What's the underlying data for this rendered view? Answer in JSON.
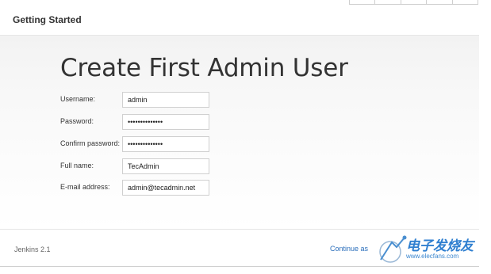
{
  "header": {
    "title": "Getting Started"
  },
  "form": {
    "title": "Create First Admin User",
    "fields": [
      {
        "label": "Username:",
        "value": "admin"
      },
      {
        "label": "Password:",
        "value": "••••••••••••••"
      },
      {
        "label": "Confirm password:",
        "value": "••••••••••••••"
      },
      {
        "label": "Full name:",
        "value": "TecAdmin"
      },
      {
        "label": "E-mail address:",
        "value": "admin@tecadmin.net"
      }
    ]
  },
  "footer": {
    "version": "Jenkins 2.1",
    "continue_label": "Continue as"
  },
  "watermark": {
    "text": "电子发烧友",
    "sub": "www.elecfans.com"
  }
}
